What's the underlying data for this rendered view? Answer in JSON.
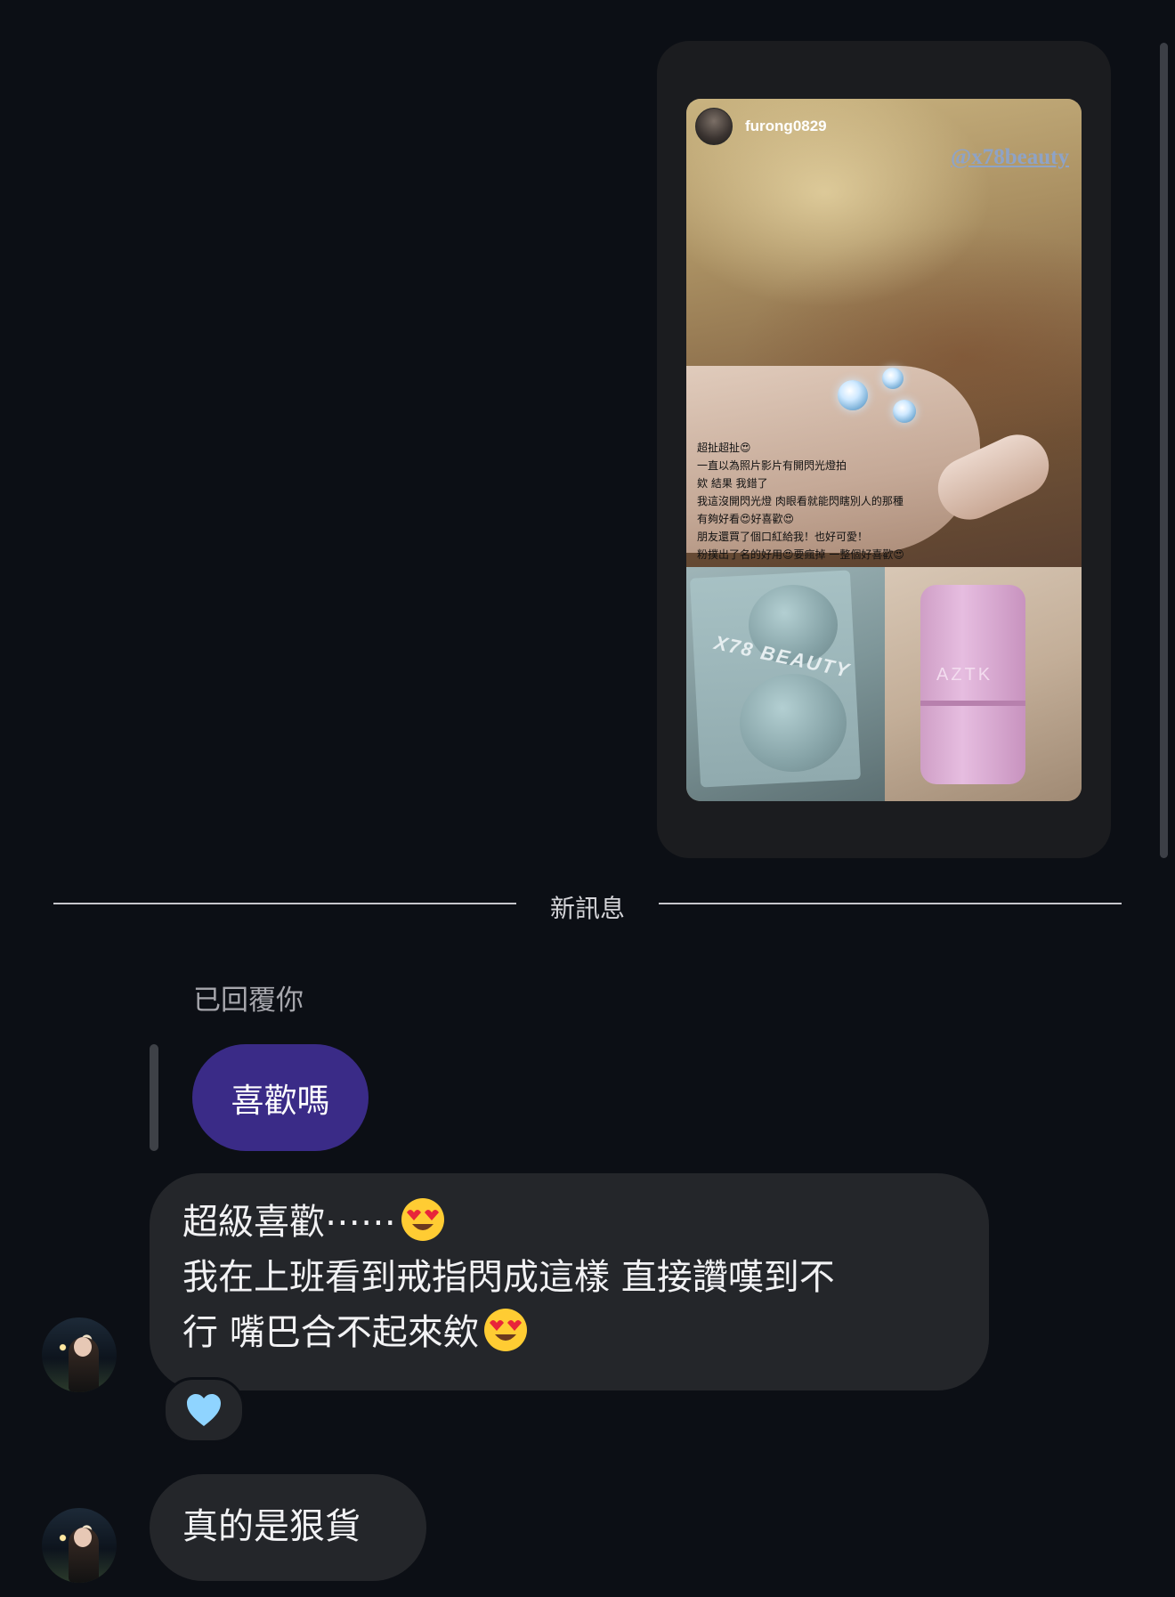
{
  "shared_post": {
    "username": "furong0829",
    "mention": "@x78beauty",
    "caption_lines": [
      "超扯超扯😍",
      "一直以為照片影片有開閃光燈拍",
      "欸 結果 我錯了",
      "我這沒開閃光燈 肉眼看就能閃瞎別人的那種",
      "有夠好看😍好喜歡😍",
      "朋友還買了個口紅給我！也好可愛！",
      "粉撲出了名的好用😍要瘋掉 一整個好喜歡😍"
    ],
    "product_print_left": "X78 BEAUTY",
    "product_print_right": "AZTK"
  },
  "divider": {
    "label": "新訊息"
  },
  "reply": {
    "note": "已回覆你",
    "quoted_text": "喜歡嗎"
  },
  "messages": [
    {
      "lines": [
        "超級喜歡⋯⋯",
        "我在上班看到戒指閃成這樣 直接讚嘆到不",
        "行 嘴巴合不起來欸"
      ],
      "reaction_icon": "light-blue-heart-icon"
    },
    {
      "text": "真的是狠貨"
    }
  ],
  "colors": {
    "background": "#0c0f15",
    "received_bubble": "#24262a",
    "quoted_bubble": "#3a2b87",
    "reaction_heart": "#8fd4ff"
  }
}
